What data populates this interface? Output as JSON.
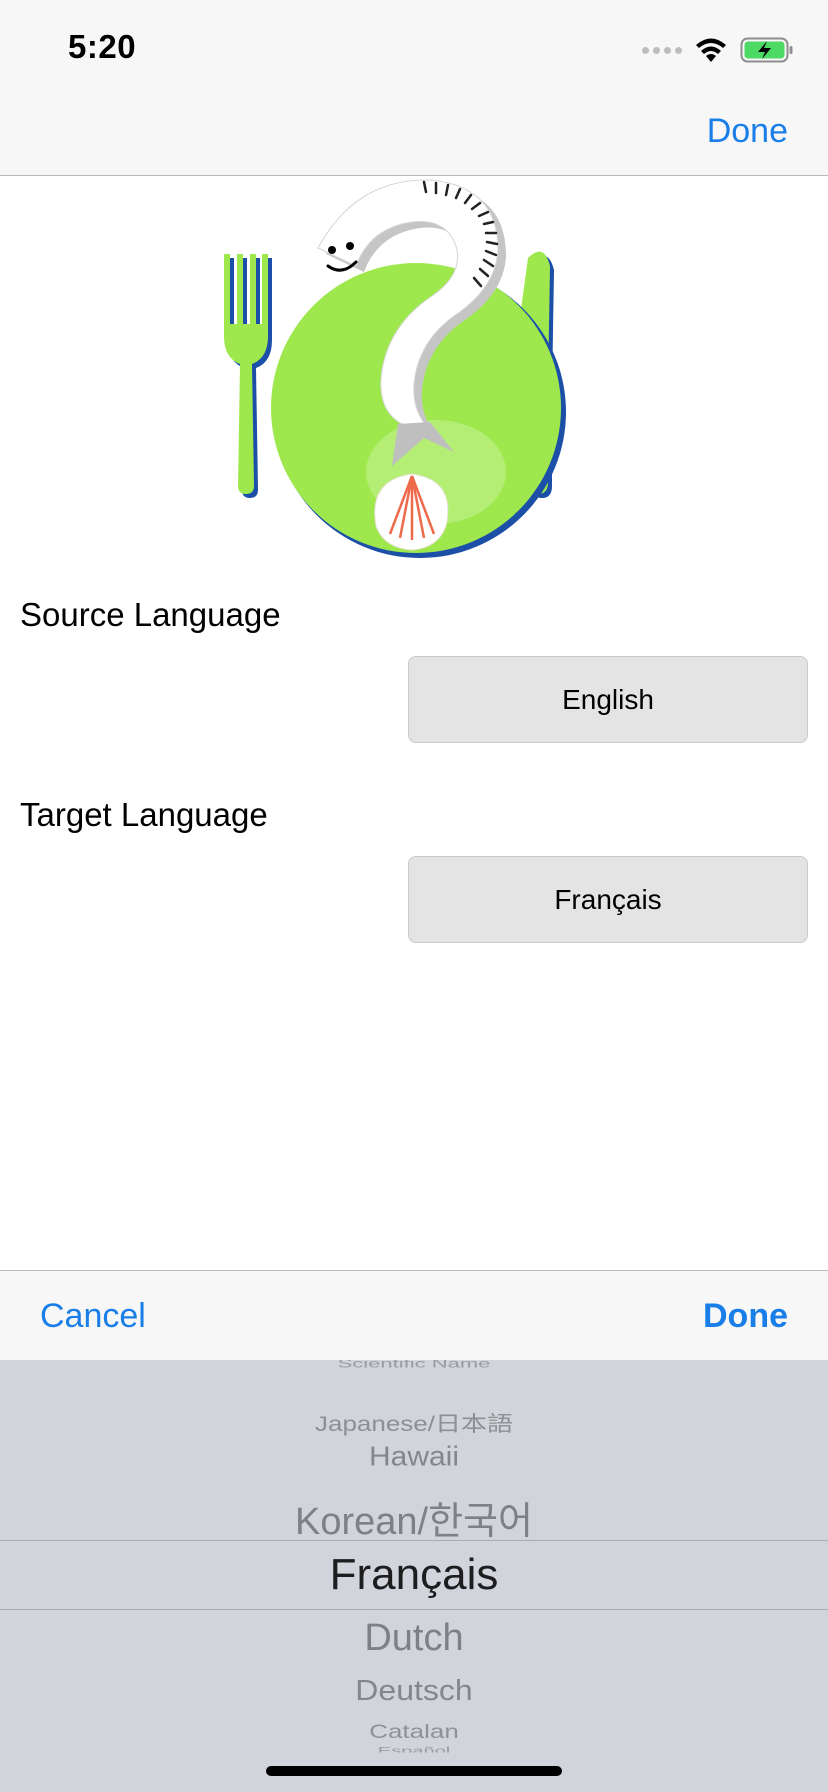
{
  "status_bar": {
    "time": "5:20"
  },
  "nav": {
    "done_label": "Done"
  },
  "form": {
    "source_label": "Source Language",
    "source_value": "English",
    "target_label": "Target Language",
    "target_value": "Français"
  },
  "picker_toolbar": {
    "cancel_label": "Cancel",
    "done_label": "Done"
  },
  "picker": {
    "rows": [
      "Scientific Name",
      "Japanese/日本語",
      "Hawaii",
      "Korean/한국어",
      "Français",
      "Dutch",
      "Deutsch",
      "Catalan",
      "Español"
    ],
    "selected": "Français"
  },
  "colors": {
    "accent": "#1a7ee8",
    "plate_green": "#9ee84e",
    "picker_bg": "#d1d4da"
  }
}
